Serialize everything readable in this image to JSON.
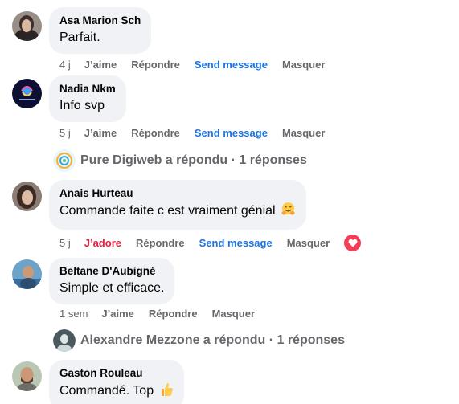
{
  "comments": [
    {
      "author": "Asa Marion Sch",
      "text": "Parfait.",
      "time": "4 j",
      "like_label": "J’aime",
      "reply_label": "Répondre",
      "send_label": "Send message",
      "hide_label": "Masquer"
    },
    {
      "author": "Nadia Nkm",
      "text": "Info svp",
      "time": "5 j",
      "like_label": "J’aime",
      "reply_label": "Répondre",
      "send_label": "Send message",
      "hide_label": "Masquer",
      "replies_text": "Pure Digiweb a répondu · 1 réponses"
    },
    {
      "author": "Anais Hurteau",
      "text": "Commande faite c est vraiment génial",
      "emoji": "hugging-face-icon",
      "time": "5 j",
      "like_label": "J’adore",
      "reply_label": "Répondre",
      "send_label": "Send message",
      "hide_label": "Masquer",
      "reaction": "love-heart-icon"
    },
    {
      "author": "Beltane D'Aubigné",
      "text": "Simple et efficace.",
      "time": "1 sem",
      "like_label": "J’aime",
      "reply_label": "Répondre",
      "hide_label": "Masquer",
      "replies_text": "Alexandre Mezzone a répondu · 1 réponses"
    },
    {
      "author": "Gaston Rouleau",
      "text": "Commandé. Top",
      "emoji": "thumbs-up-icon"
    }
  ],
  "colors": {
    "bubble": "#f0f2f5",
    "meta": "#65676b",
    "send_link": "#1b74e4",
    "love": "#e41e3f",
    "love_badge": "#f33e58"
  }
}
